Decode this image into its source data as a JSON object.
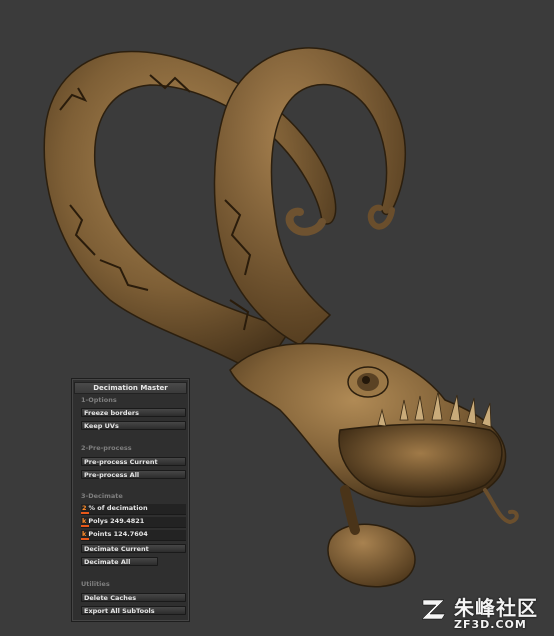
{
  "panel": {
    "title": "Decimation Master",
    "options_header": "1-Options",
    "freeze_borders": "Freeze borders",
    "keep_uvs": "Keep UVs",
    "preprocess_header": "2-Pre-process",
    "preprocess_current": "Pre-process Current",
    "preprocess_all": "Pre-process All",
    "decimate_header": "3-Decimate",
    "percent_value": "2",
    "percent_label": "% of decimation",
    "percent_fraction": 0.02,
    "polys_value": "k",
    "polys_label": "Polys 249.4821",
    "points_value": "k",
    "points_label": "Points 124.7604",
    "decimate_current": "Decimate Current",
    "decimate_all": "Decimate All",
    "utilities_header": "Utilities",
    "delete_caches": "Delete Caches",
    "export_all_subtools": "Export All SubTools"
  },
  "watermark": {
    "cn": "朱峰社区",
    "en": "ZF3D.COM"
  },
  "colors": {
    "background": "#3b3b3b",
    "model": "#8a6a3f",
    "accent": "#e8581a"
  }
}
